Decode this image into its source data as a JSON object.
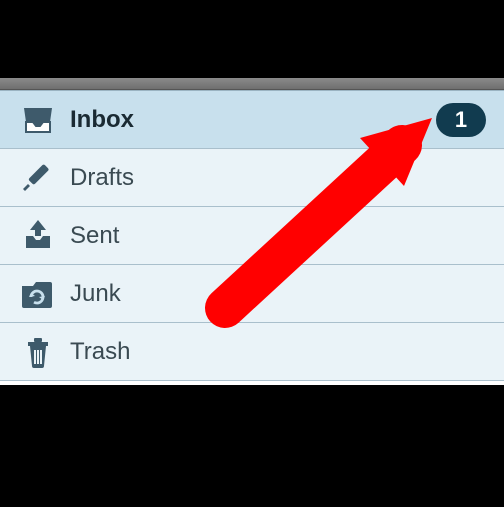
{
  "folders": {
    "inbox": {
      "label": "Inbox",
      "count": "1"
    },
    "drafts": {
      "label": "Drafts"
    },
    "sent": {
      "label": "Sent"
    },
    "junk": {
      "label": "Junk"
    },
    "trash": {
      "label": "Trash"
    }
  },
  "colors": {
    "icon": "#3e5a6b",
    "badge_bg": "#113b4f",
    "arrow": "#ff0000"
  }
}
